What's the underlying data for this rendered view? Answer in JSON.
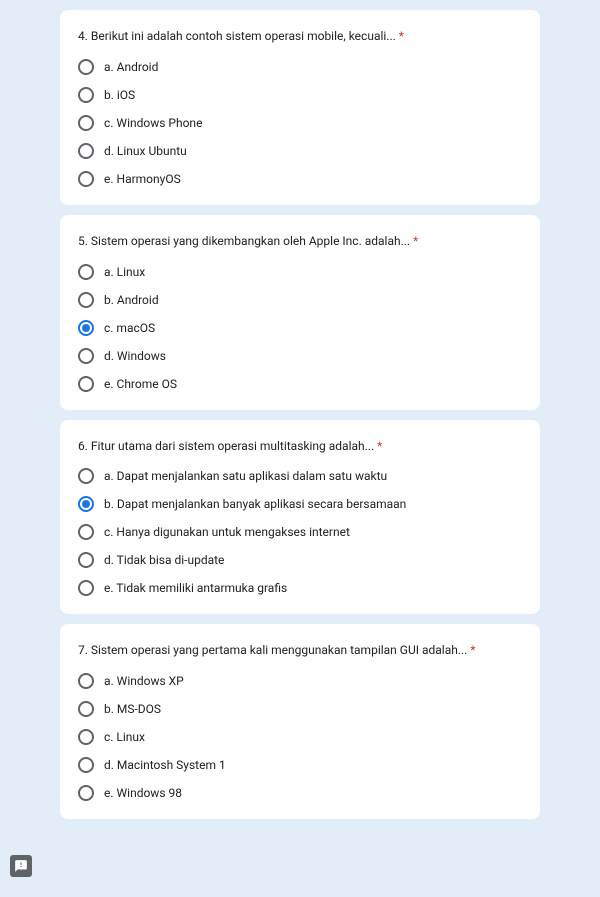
{
  "questions": [
    {
      "title": "4.  Berikut ini adalah contoh sistem operasi mobile, kecuali... ",
      "required": "*",
      "options": [
        {
          "label": "a. Android",
          "selected": false
        },
        {
          "label": "b. iOS",
          "selected": false
        },
        {
          "label": "c. Windows Phone",
          "selected": false
        },
        {
          "label": "d. Linux Ubuntu",
          "selected": false
        },
        {
          "label": "e. HarmonyOS",
          "selected": false
        }
      ]
    },
    {
      "title": "5. Sistem operasi yang dikembangkan oleh Apple Inc. adalah... ",
      "required": "*",
      "options": [
        {
          "label": "a. Linux",
          "selected": false
        },
        {
          "label": "b. Android",
          "selected": false
        },
        {
          "label": "c. macOS",
          "selected": true
        },
        {
          "label": "d. Windows",
          "selected": false
        },
        {
          "label": "e. Chrome OS",
          "selected": false
        }
      ]
    },
    {
      "title": "6.  Fitur utama dari sistem operasi multitasking adalah...  ",
      "required": "*",
      "options": [
        {
          "label": "a. Dapat menjalankan satu aplikasi dalam satu waktu",
          "selected": false
        },
        {
          "label": "b. Dapat menjalankan banyak aplikasi secara bersamaan",
          "selected": true
        },
        {
          "label": "c. Hanya digunakan untuk mengakses internet",
          "selected": false
        },
        {
          "label": "d. Tidak bisa di-update",
          "selected": false
        },
        {
          "label": "e. Tidak memiliki antarmuka grafis",
          "selected": false
        }
      ]
    },
    {
      "title": "7.  Sistem operasi yang pertama kali menggunakan tampilan GUI adalah... ",
      "required": "*",
      "options": [
        {
          "label": "a. Windows XP",
          "selected": false
        },
        {
          "label": "b. MS-DOS",
          "selected": false
        },
        {
          "label": "c. Linux",
          "selected": false
        },
        {
          "label": "d. Macintosh System 1",
          "selected": false
        },
        {
          "label": "e. Windows 98",
          "selected": false
        }
      ]
    }
  ]
}
